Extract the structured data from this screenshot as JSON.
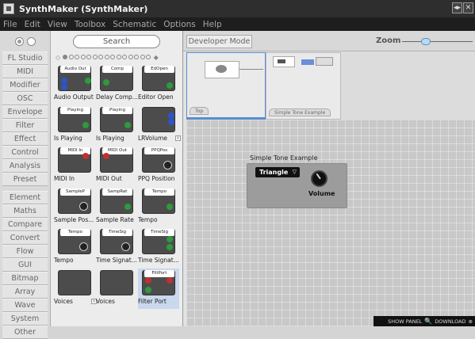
{
  "window": {
    "title": "SynthMaker (SynthMaker)"
  },
  "menu": [
    "File",
    "Edit",
    "View",
    "Toolbox",
    "Schematic",
    "Options",
    "Help"
  ],
  "sidebar": {
    "groups": [
      [
        "FL Studio",
        "MIDI",
        "Modifier",
        "OSC",
        "Envelope",
        "Filter",
        "Effect",
        "Control",
        "Analysis",
        "Preset"
      ],
      [
        "Element",
        "Maths",
        "Compare",
        "Convert",
        "Flow",
        "GUI",
        "Bitmap",
        "Array",
        "Wave",
        "System",
        "Other"
      ]
    ]
  },
  "toolbox": {
    "search_placeholder": "Search",
    "modules": [
      {
        "label": "Audio Output",
        "header": "Audio Out"
      },
      {
        "label": "Delay Comp...",
        "header": "Comp"
      },
      {
        "label": "Editor Open",
        "header": "EdOpen"
      },
      {
        "label": "Is Playing",
        "header": "Playing"
      },
      {
        "label": "Is Playing",
        "header": "Playing"
      },
      {
        "label": "LRVolume",
        "header": ""
      },
      {
        "label": "MIDI In",
        "header": "MIDI In"
      },
      {
        "label": "MIDI Out",
        "header": "MIDI Out"
      },
      {
        "label": "PPQ Position",
        "header": "PPQPos"
      },
      {
        "label": "Sample Pos...",
        "header": "SampleP"
      },
      {
        "label": "Sample Rate",
        "header": "SampRat"
      },
      {
        "label": "Tempo",
        "header": "Tempo"
      },
      {
        "label": "Tempo",
        "header": "Tempo"
      },
      {
        "label": "Time Signat...",
        "header": "TimeSig"
      },
      {
        "label": "Time Signat...",
        "header": "TimeSig"
      },
      {
        "label": "Voices",
        "header": ""
      },
      {
        "label": "Voices",
        "header": ""
      },
      {
        "label": "Filter Port",
        "header": "FiltPort"
      }
    ]
  },
  "main": {
    "dev_mode_label": "Developer Mode",
    "zoom_label": "Zoom",
    "nav_tabs": [
      "Top",
      "Simple Tone Example"
    ],
    "module_title": "Simple Tone Example",
    "dropdown_value": "Triangle",
    "knob_label": "Volume",
    "footer_show": "SHOW PANEL",
    "footer_download": "DOWNLOAD"
  },
  "colors": {
    "accent": "#5a8cd0",
    "port_green": "#2e9a3d",
    "port_blue": "#2c55c9",
    "port_red": "#c23030"
  }
}
